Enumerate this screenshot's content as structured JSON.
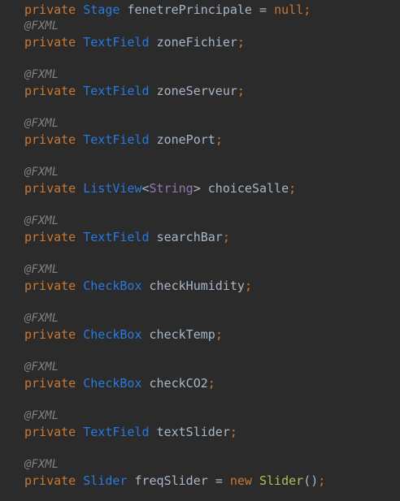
{
  "lines": [
    {
      "kind": "field",
      "modifier": "private",
      "type": "Stage",
      "name": "fenetrePrincipale",
      "assign_op": "=",
      "value": "null",
      "semicolon": ";"
    },
    {
      "kind": "annotation",
      "text": "@FXML"
    },
    {
      "kind": "field",
      "modifier": "private",
      "type": "TextField",
      "name": "zoneFichier",
      "semicolon": ";"
    },
    {
      "kind": "annotation",
      "text": "@FXML"
    },
    {
      "kind": "field",
      "modifier": "private",
      "type": "TextField",
      "name": "zoneServeur",
      "semicolon": ";"
    },
    {
      "kind": "annotation",
      "text": "@FXML"
    },
    {
      "kind": "field",
      "modifier": "private",
      "type": "TextField",
      "name": "zonePort",
      "semicolon": ";"
    },
    {
      "kind": "annotation",
      "text": "@FXML"
    },
    {
      "kind": "field",
      "modifier": "private",
      "type": "ListView",
      "generic_open": "<",
      "generic": "String",
      "generic_close": ">",
      "name": "choiceSalle",
      "semicolon": ";"
    },
    {
      "kind": "annotation",
      "text": "@FXML"
    },
    {
      "kind": "field",
      "modifier": "private",
      "type": "TextField",
      "name": "searchBar",
      "semicolon": ";"
    },
    {
      "kind": "annotation",
      "text": "@FXML"
    },
    {
      "kind": "field",
      "modifier": "private",
      "type": "CheckBox",
      "name": "checkHumidity",
      "semicolon": ";"
    },
    {
      "kind": "annotation",
      "text": "@FXML"
    },
    {
      "kind": "field",
      "modifier": "private",
      "type": "CheckBox",
      "name": "checkTemp",
      "semicolon": ";"
    },
    {
      "kind": "annotation",
      "text": "@FXML"
    },
    {
      "kind": "field",
      "modifier": "private",
      "type": "CheckBox",
      "name": "checkCO2",
      "semicolon": ";"
    },
    {
      "kind": "annotation",
      "text": "@FXML"
    },
    {
      "kind": "field",
      "modifier": "private",
      "type": "TextField",
      "name": "textSlider",
      "semicolon": ";"
    },
    {
      "kind": "annotation",
      "text": "@FXML"
    },
    {
      "kind": "field",
      "modifier": "private",
      "type": "Slider",
      "name": "freqSlider",
      "assign_op": "=",
      "value": "new",
      "ctor": "Slider",
      "ctor_args": "()",
      "semicolon": ";"
    }
  ],
  "colors": {
    "background": "#2b2b2b",
    "keyword": "#cc7832",
    "type": "#287bde",
    "identifier": "#a9b7c6",
    "annotation": "#808080",
    "generic": "#9876aa",
    "constructor": "#a5c25c"
  }
}
